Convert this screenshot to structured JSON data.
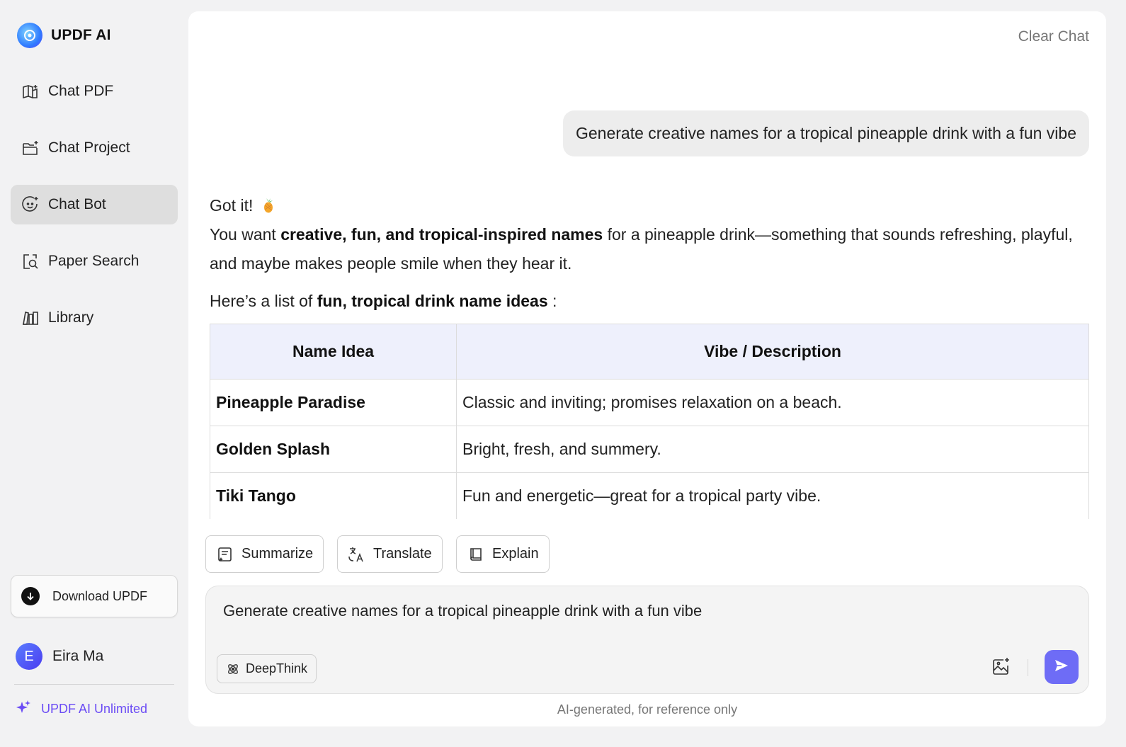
{
  "brand": {
    "name": "UPDF AI",
    "logo_icon": "updf-ai-logo-icon"
  },
  "sidebar": {
    "items": [
      {
        "label": "Chat PDF",
        "icon": "book-sparkle-icon",
        "active": false
      },
      {
        "label": "Chat Project",
        "icon": "folder-sparkle-icon",
        "active": false
      },
      {
        "label": "Chat Bot",
        "icon": "bot-face-icon",
        "active": true
      },
      {
        "label": "Paper Search",
        "icon": "paper-search-icon",
        "active": false
      },
      {
        "label": "Library",
        "icon": "library-icon",
        "active": false
      }
    ],
    "download_label": "Download UPDF",
    "user": {
      "initial": "E",
      "name": "Eira Ma"
    },
    "unlimited_label": "UPDF AI Unlimited"
  },
  "main": {
    "clear_chat": "Clear Chat",
    "user_message": "Generate creative names for a tropical pineapple drink with a fun vibe",
    "answer": {
      "greeting": "Got it!",
      "p2_prefix": "You want ",
      "p2_bold": "creative, fun, and tropical-inspired names",
      "p2_suffix": " for a pineapple drink—something that sounds refreshing, playful, and maybe makes people smile when they hear it.",
      "p3_prefix": "Here’s a list of ",
      "p3_bold": "fun, tropical drink name ideas",
      "p3_suffix": " :"
    },
    "table": {
      "headers": [
        "Name Idea",
        "Vibe / Description"
      ],
      "rows": [
        [
          "Pineapple Paradise",
          "Classic and inviting; promises relaxation on a beach."
        ],
        [
          "Golden Splash",
          "Bright, fresh, and summery."
        ],
        [
          "Tiki Tango",
          "Fun and energetic—great for a tropical party vibe."
        ]
      ]
    },
    "actions": [
      "Summarize",
      "Translate",
      "Explain"
    ],
    "input": {
      "value": "Generate creative names for a tropical pineapple drink with a fun vibe",
      "deepthink_label": "DeepThink"
    },
    "disclaimer": "AI-generated, for reference only"
  },
  "colors": {
    "accent": "#6e6cf6",
    "unlimited": "#6b4cf5",
    "table_header": "#eef0fc"
  }
}
